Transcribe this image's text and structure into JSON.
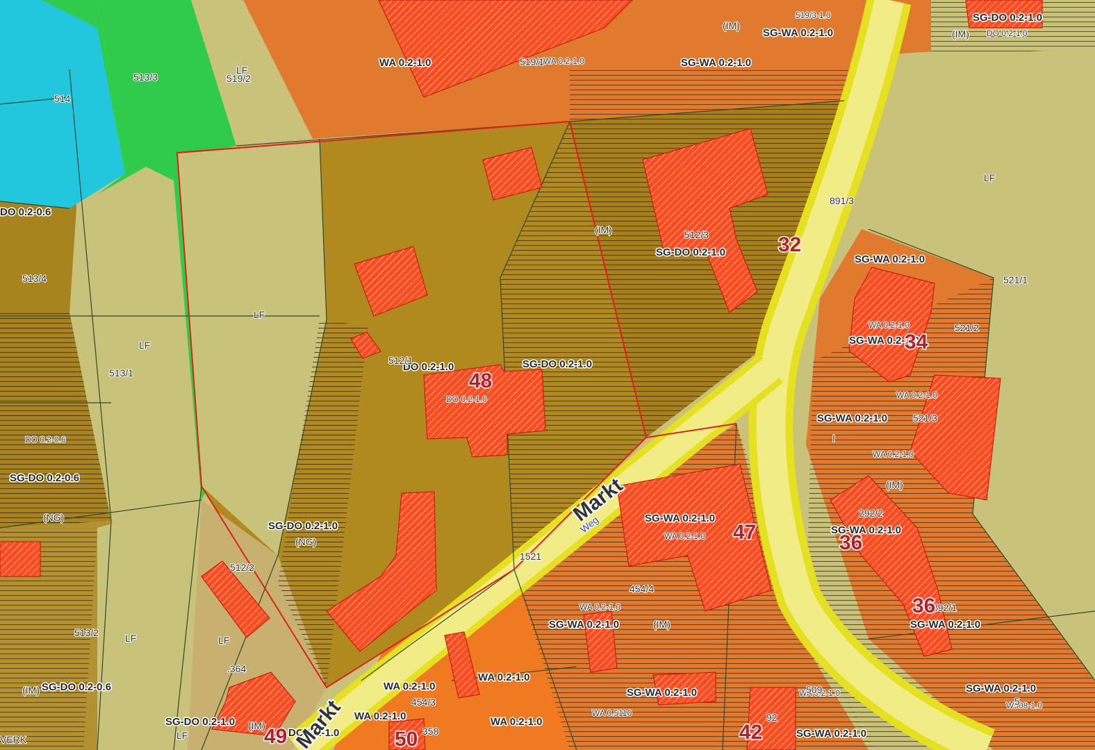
{
  "colors": {
    "residential_wa": "#e07a2e",
    "village_do": "#b08a1e",
    "agriculture_lf": "#c9c27a",
    "water": "#22c6dd",
    "green": "#2ecc4a",
    "road": "#f2ec86",
    "road_edge": "#e5e020",
    "building": "#ff3b1e",
    "boundary": "#e0201a"
  },
  "zone_labels": [
    {
      "text": "WA 0.2-1.0"
    },
    {
      "text": "SG-WA 0.2-1.0"
    },
    {
      "text": "SG-WA 0.2-1.0"
    },
    {
      "text": "SG-DO 0.2-1.0"
    },
    {
      "text": "DO 0.2-0.6"
    },
    {
      "text": "SG-DO 0.2-1.0"
    },
    {
      "text": "DO 0.2-1.0"
    },
    {
      "text": "SG-DO 0.2-1.0"
    },
    {
      "text": "SG-WA 0.2-1.0"
    },
    {
      "text": "SG-WA 0.2-1.0"
    },
    {
      "text": "SG-WA 0.2-1.0"
    },
    {
      "text": "SG-DO 0.2-0.6"
    },
    {
      "text": "SG-DO 0.2-1.0"
    },
    {
      "text": "SG-WA 0.2-1.0"
    },
    {
      "text": "SG-WA 0.2-1.0"
    },
    {
      "text": "SG-WA 0.2-1.0"
    },
    {
      "text": "SG-DO 0.2-0.6"
    },
    {
      "text": "WA 0.2-1.0"
    },
    {
      "text": "WA 0.2-1.0"
    },
    {
      "text": "SG-WA 0.2-1.0"
    },
    {
      "text": "SG-WA 0.2-1.0"
    },
    {
      "text": "WA 0.2-1.0"
    },
    {
      "text": "WA 0.2-1.0"
    },
    {
      "text": "SG-DO 0.2-1.0"
    },
    {
      "text": "DO 0.2-1.0"
    },
    {
      "text": "SG-WA 0.2-1.0"
    },
    {
      "text": "SG-WA 0.2-1.0"
    }
  ],
  "small_labels": [
    {
      "text": "519/3-1.0"
    },
    {
      "text": "DO 0.2-1.0"
    },
    {
      "text": "WA 0.2-1.0"
    },
    {
      "text": "DO 0.2-0.6"
    },
    {
      "text": "DO 0.2-1.0"
    },
    {
      "text": "WA 0.2-1.0"
    },
    {
      "text": "WA 0.2-1.0"
    },
    {
      "text": "WA 0.2-1.0"
    },
    {
      "text": "WA 0.2-1.0"
    },
    {
      "text": "WA 0.5110"
    },
    {
      "text": "W508-1.0"
    },
    {
      "text": "WA 0.2-1.0"
    },
    {
      "text": "WA 0.2-1.0"
    }
  ],
  "parcel_labels": [
    {
      "text": "513/3"
    },
    {
      "text": "LF"
    },
    {
      "text": "519/2"
    },
    {
      "text": "514"
    },
    {
      "text": "519/1"
    },
    {
      "text": "(IM)"
    },
    {
      "text": "891/3"
    },
    {
      "text": "LF"
    },
    {
      "text": "(IM)"
    },
    {
      "text": "512/3"
    },
    {
      "text": "513/4"
    },
    {
      "text": "521/1"
    },
    {
      "text": "LF"
    },
    {
      "text": "LF"
    },
    {
      "text": "521/2"
    },
    {
      "text": "513/1"
    },
    {
      "text": "512/1"
    },
    {
      "text": "521/3"
    },
    {
      "text": "(NG)"
    },
    {
      "text": "(NG)"
    },
    {
      "text": "(IM)"
    },
    {
      "text": "1521"
    },
    {
      "text": "292/2"
    },
    {
      "text": "512/2"
    },
    {
      "text": "454/4"
    },
    {
      "text": "292/1"
    },
    {
      "text": "513/2"
    },
    {
      "text": "LF"
    },
    {
      "text": "LF"
    },
    {
      "text": "(IM)"
    },
    {
      "text": ".364"
    },
    {
      "text": "(IM)"
    },
    {
      "text": "454/3"
    },
    {
      "text": "LF"
    },
    {
      "text": "358"
    },
    {
      "text": "509"
    },
    {
      "text": "92"
    },
    {
      "text": "VERK"
    },
    {
      "text": "5"
    },
    {
      "text": "(IM)"
    },
    {
      "text": "(IM)"
    },
    {
      "text": "I"
    }
  ],
  "house_numbers": [
    {
      "text": "32"
    },
    {
      "text": "34"
    },
    {
      "text": "48"
    },
    {
      "text": "47"
    },
    {
      "text": "36"
    },
    {
      "text": "36"
    },
    {
      "text": "49"
    },
    {
      "text": "50"
    },
    {
      "text": "42"
    }
  ],
  "street_labels": [
    {
      "text": "Markt"
    },
    {
      "text": "Weg"
    },
    {
      "text": "Markt"
    }
  ]
}
